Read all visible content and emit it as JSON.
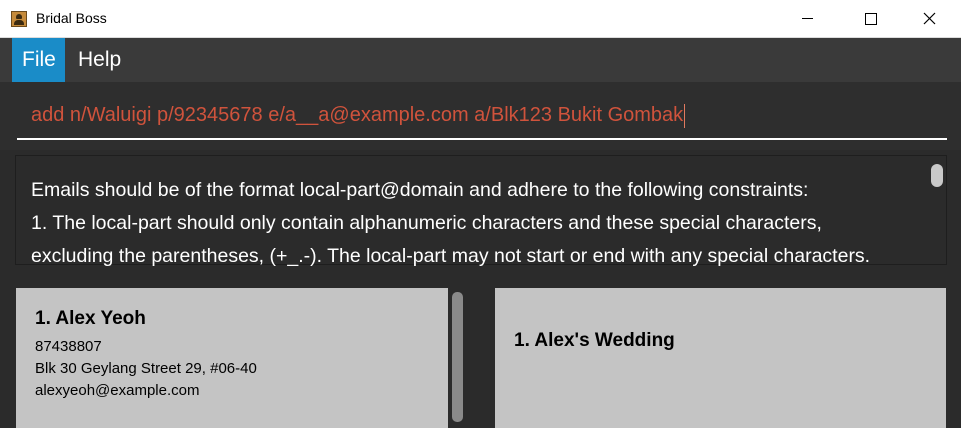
{
  "window": {
    "title": "Bridal Boss",
    "icon": "app-icon"
  },
  "menu": {
    "items": [
      {
        "label": "File",
        "active": true
      },
      {
        "label": "Help",
        "active": false
      }
    ]
  },
  "command_box": {
    "value": "add n/Waluigi p/92345678 e/a__a@example.com a/Blk123 Bukit Gombak",
    "text_color": "#d0533c"
  },
  "result_display": {
    "lines": [
      "Emails should be of the format local-part@domain and adhere to the following constraints:",
      "1. The local-part should only contain alphanumeric characters and these special characters,",
      "excluding the parentheses, (+_.-). The local-part may not start or end with any special characters."
    ]
  },
  "person_list": {
    "cards": [
      {
        "title": "1. Alex Yeoh",
        "phone": "87438807",
        "address": "Blk 30 Geylang Street 29, #06-40",
        "email": "alexyeoh@example.com"
      }
    ]
  },
  "wedding_list": {
    "cards": [
      {
        "title": "1. Alex's Wedding"
      }
    ]
  },
  "colors": {
    "accent": "#1a8cc8",
    "background": "#2b2b2b",
    "card": "#c4c4c4"
  }
}
